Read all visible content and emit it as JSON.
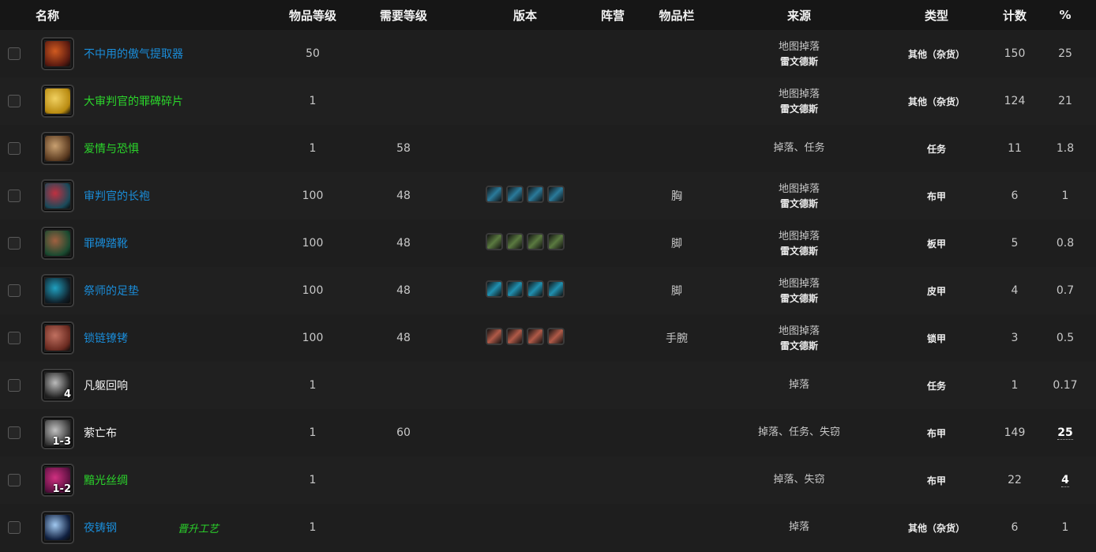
{
  "columns": [
    "名称",
    "物品等级",
    "需要等级",
    "版本",
    "阵营",
    "物品栏",
    "来源",
    "类型",
    "计数",
    "%"
  ],
  "rows": [
    {
      "name": "不中用的傲气提取器",
      "quality": "blue",
      "ilvl": "50",
      "req": "",
      "versions": 0,
      "slot": "",
      "src1": "地图掉落",
      "src2": "雷文德斯",
      "type": "其他（杂货）",
      "count": "150",
      "pct": "25",
      "pct_u": false,
      "icon": "drainer-icon",
      "c1": "#5a1a10",
      "c2": "#d05a20",
      "stack": "",
      "note": ""
    },
    {
      "name": "大审判官的罪碑碎片",
      "quality": "green",
      "ilvl": "1",
      "req": "",
      "versions": 0,
      "slot": "",
      "src1": "地图掉落",
      "src2": "雷文德斯",
      "type": "其他（杂货）",
      "count": "124",
      "pct": "21",
      "pct_u": false,
      "icon": "sin-stone-icon",
      "c1": "#b88a10",
      "c2": "#f0d060",
      "stack": "",
      "note": ""
    },
    {
      "name": "爱情与恐惧",
      "quality": "green",
      "ilvl": "1",
      "req": "58",
      "versions": 0,
      "slot": "",
      "src1": "掉落、任务",
      "src2": "",
      "type": "任务",
      "count": "11",
      "pct": "1.8",
      "pct_u": false,
      "icon": "letter-icon",
      "c1": "#5a3a20",
      "c2": "#c8a070",
      "stack": "",
      "note": ""
    },
    {
      "name": "审判官的长袍",
      "quality": "blue",
      "ilvl": "100",
      "req": "48",
      "versions": 4,
      "slot": "胸",
      "src1": "地图掉落",
      "src2": "雷文德斯",
      "type": "布甲",
      "count": "6",
      "pct": "1",
      "pct_u": false,
      "icon": "robe-icon",
      "c1": "#1a4a5a",
      "c2": "#c03040",
      "vc": "#2a7a9a",
      "stack": "",
      "note": ""
    },
    {
      "name": "罪碑踏靴",
      "quality": "blue",
      "ilvl": "100",
      "req": "48",
      "versions": 4,
      "slot": "脚",
      "src1": "地图掉落",
      "src2": "雷文德斯",
      "type": "板甲",
      "count": "5",
      "pct": "0.8",
      "pct_u": false,
      "icon": "boots-icon",
      "c1": "#1a4a30",
      "c2": "#a06040",
      "vc": "#5a7a40",
      "stack": "",
      "note": ""
    },
    {
      "name": "祭师的足垫",
      "quality": "blue",
      "ilvl": "100",
      "req": "48",
      "versions": 4,
      "slot": "脚",
      "src1": "地图掉落",
      "src2": "雷文德斯",
      "type": "皮甲",
      "count": "4",
      "pct": "0.7",
      "pct_u": false,
      "icon": "footpads-icon",
      "c1": "#10202a",
      "c2": "#20a0c0",
      "vc": "#2090b0",
      "stack": "",
      "note": ""
    },
    {
      "name": "锁链镣铐",
      "quality": "blue",
      "ilvl": "100",
      "req": "48",
      "versions": 4,
      "slot": "手腕",
      "src1": "地图掉落",
      "src2": "雷文德斯",
      "type": "锁甲",
      "count": "3",
      "pct": "0.5",
      "pct_u": false,
      "icon": "bracers-icon",
      "c1": "#6a2a20",
      "c2": "#c07060",
      "vc": "#b05a48",
      "stack": "",
      "note": ""
    },
    {
      "name": "凡躯回响",
      "quality": "white",
      "ilvl": "1",
      "req": "",
      "versions": 0,
      "slot": "",
      "src1": "掉落",
      "src2": "",
      "type": "任务",
      "count": "1",
      "pct": "0.17",
      "pct_u": false,
      "icon": "echo-icon",
      "c1": "#222",
      "c2": "#bbb",
      "stack": "4",
      "note": ""
    },
    {
      "name": "萦亡布",
      "quality": "white",
      "ilvl": "1",
      "req": "60",
      "versions": 0,
      "slot": "",
      "src1": "掉落、任务、失窃",
      "src2": "",
      "type": "布甲",
      "count": "149",
      "pct": "25",
      "pct_u": true,
      "icon": "cloth-icon",
      "c1": "#3a3a3a",
      "c2": "#c0c0c0",
      "stack": "1-3",
      "note": ""
    },
    {
      "name": "黯光丝绸",
      "quality": "green",
      "ilvl": "1",
      "req": "",
      "versions": 0,
      "slot": "",
      "src1": "掉落、失窃",
      "src2": "",
      "type": "布甲",
      "count": "22",
      "pct": "4",
      "pct_u": true,
      "icon": "silk-icon",
      "c1": "#5a1040",
      "c2": "#d03080",
      "stack": "1-2",
      "note": ""
    },
    {
      "name": "夜铸钢",
      "quality": "blue",
      "ilvl": "1",
      "req": "",
      "versions": 0,
      "slot": "",
      "src1": "掉落",
      "src2": "",
      "type": "其他（杂货）",
      "count": "6",
      "pct": "1",
      "pct_u": false,
      "icon": "steel-icon",
      "c1": "#102040",
      "c2": "#a0c8f0",
      "stack": "",
      "note": "晋升工艺"
    }
  ]
}
